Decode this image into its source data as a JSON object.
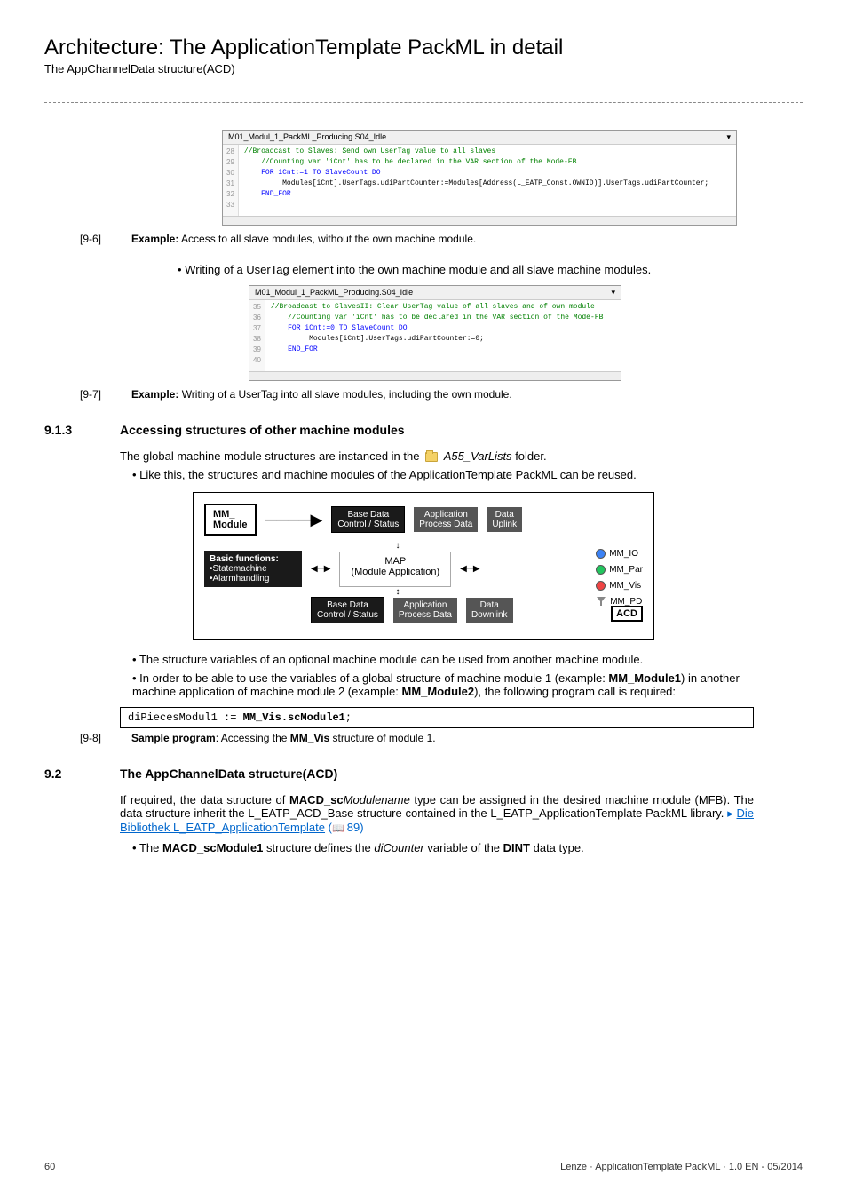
{
  "page": {
    "title": "Architecture: The ApplicationTemplate PackML in detail",
    "subtitle": "The AppChannelData structure(ACD)"
  },
  "codeshot1": {
    "header": "M01_Modul_1_PackML_Producing.S04_Idle",
    "gutter": "28\n29\n30\n31\n32\n33",
    "l1": "//Broadcast to Slaves: Send own UserTag value to all slaves",
    "l2": "//Counting var 'iCnt' has to be declared in the VAR section of the Mode-FB",
    "l3": "FOR iCnt:=1 TO SlaveCount DO",
    "l4": "    Modules[iCnt].UserTags.udiPartCounter:=Modules[Address(L_EATP_Const.OWNID)].UserTags.udiPartCounter;",
    "l5": "END_FOR"
  },
  "cap96": {
    "ref": "[9-6]",
    "label_b": "Example:",
    "text": " Access to all slave modules, without the own machine module."
  },
  "bullet1": "Writing of a UserTag element into the own machine module and all slave machine modules.",
  "codeshot2": {
    "header": "M01_Modul_1_PackML_Producing.S04_Idle",
    "gutter": "35\n36\n37\n38\n39\n40",
    "l1": "//Broadcast to SlavesII: Clear UserTag value of all slaves and of own module",
    "l2": "//Counting var 'iCnt' has to be declared in the VAR section of the Mode-FB",
    "l3": "FOR iCnt:=0 TO SlaveCount DO",
    "l4": "    Modules[iCnt].UserTags.udiPartCounter:=0;",
    "l5": "END_FOR"
  },
  "cap97": {
    "ref": "[9-7]",
    "label_b": "Example:",
    "text": " Writing of a UserTag into all slave modules, including the own module."
  },
  "sec913": {
    "num": "9.1.3",
    "title": "Accessing structures of other machine modules",
    "p1a": "The global machine module structures are instanced in the ",
    "p1b": "A55_VarLists",
    "p1c": " folder.",
    "b1": "Like this, the structures and machine modules of the ApplicationTemplate PackML can be reused.",
    "b2": "The structure variables of an optional machine module can be used from another machine module.",
    "b3a": "In order to be able to use the variables of a global structure of machine module 1 (example: ",
    "b3mm1": "MM_Module1",
    "b3b": ") in another machine application of machine module 2 (example: ",
    "b3mm2": "MM_Module2",
    "b3c": "), the following program call is required:"
  },
  "diagram": {
    "mm": "MM_\nModule",
    "bd1": "Base Data",
    "bd2": "Control / Status",
    "app": "Application",
    "pd": "Process Data",
    "du": "Data\nUplink",
    "funcs_t": "Basic functions:",
    "funcs_1": "•Statemachine",
    "funcs_2": "•Alarmhandling",
    "map": "MAP",
    "map2": "(Module Application)",
    "dd": "Data\nDownlink",
    "p_io": "MM_IO",
    "p_par": "MM_Par",
    "p_vis": "MM_Vis",
    "p_pd": "MM_PD",
    "acd": "ACD"
  },
  "sample_code": {
    "code_a": "diPiecesModul1 := ",
    "code_b": "MM_Vis.scModule1",
    "code_c": ";"
  },
  "cap98": {
    "ref": "[9-8]",
    "label_b": "Sample program",
    "text_a": ": Accessing the ",
    "text_b": "MM_Vis",
    "text_c": " structure of module 1."
  },
  "sec92": {
    "num": "9.2",
    "title": "The AppChannelData structure(ACD)",
    "p1a": "If required, the data structure of ",
    "p1b": "MACD_sc",
    "p1c": "Modulename",
    "p1d": " type can be assigned in the desired machine module (MFB). The data structure inherit the L_EATP_ACD_Base structure contained in the L_EATP_ApplicationTemplate PackML library.  ",
    "link": "Die Bibliothek L_EATP_ApplicationTemplate",
    "linkpage": "89",
    "b1a": "The ",
    "b1b": "MACD_scModule1",
    "b1c": " structure defines the ",
    "b1d": "diCounter",
    "b1e": " variable of the ",
    "b1f": "DINT",
    "b1g": " data type."
  },
  "footer": {
    "page": "60",
    "right": "Lenze · ApplicationTemplate PackML · 1.0 EN - 05/2014"
  }
}
